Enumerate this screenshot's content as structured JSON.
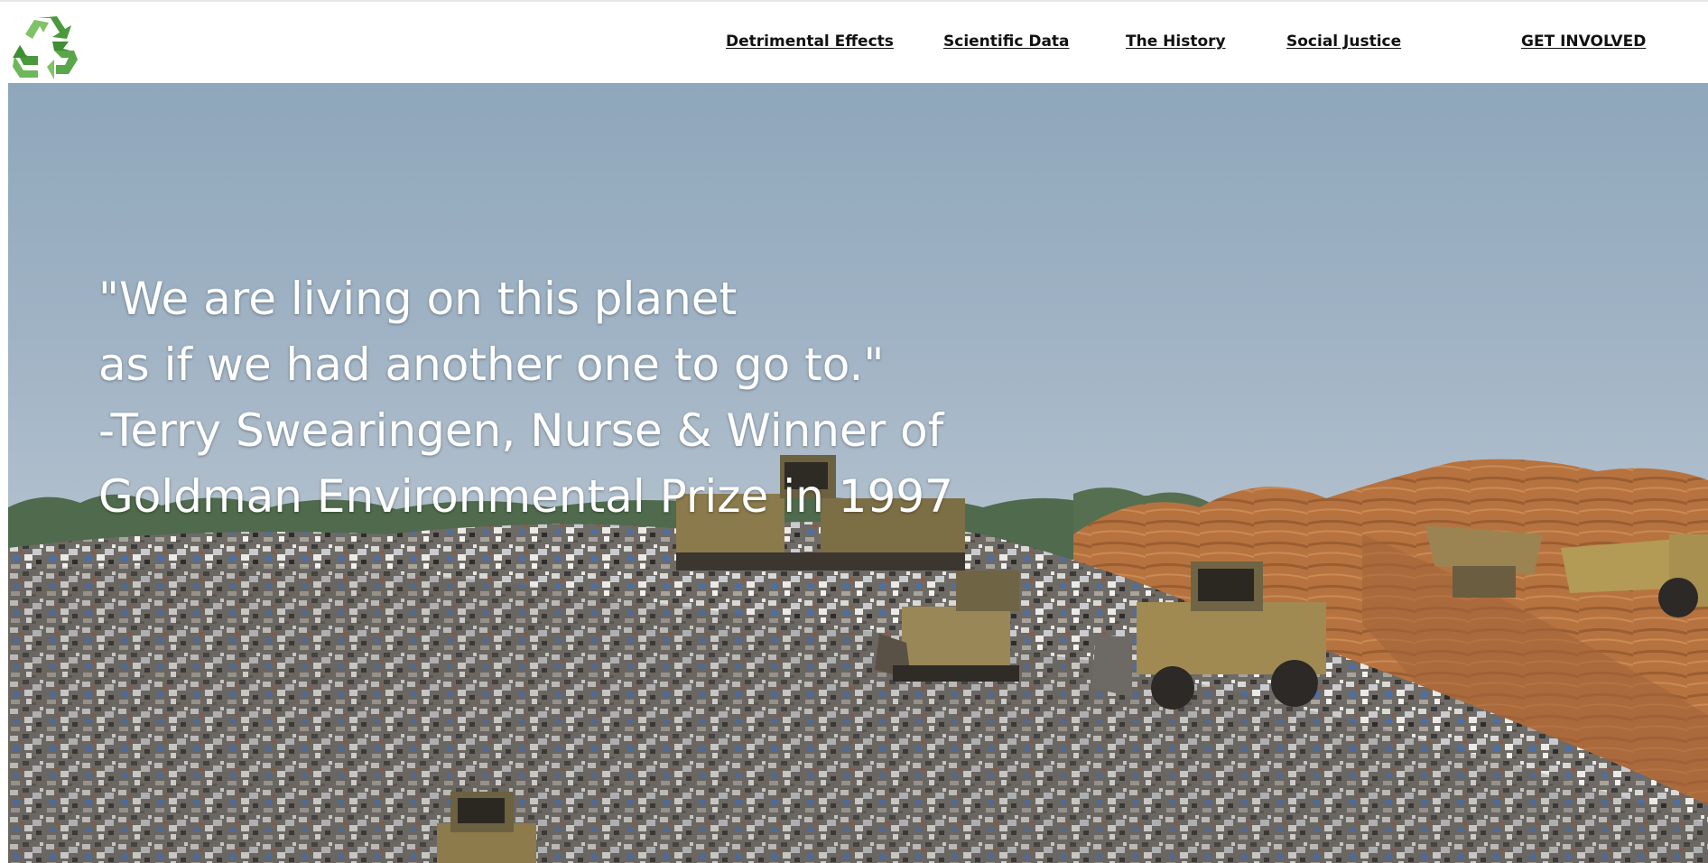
{
  "nav": {
    "logo_icon": "recycle-icon",
    "links": [
      {
        "label": "Detrimental Effects"
      },
      {
        "label": "Scientific Data"
      },
      {
        "label": "The History"
      },
      {
        "label": "Social Justice"
      },
      {
        "label": "GET INVOLVED"
      }
    ]
  },
  "hero": {
    "image": "landfill-bulldozers-image",
    "quote_lines": [
      "\"We are living on this planet",
      "as if we had another one to go to.\"",
      "-Terry Swearingen, Nurse & Winner of",
      "Goldman Environmental Prize in 1997"
    ]
  },
  "colors": {
    "sky": "#9eb2c4",
    "recycle_green": "#5aa64a",
    "text_dark": "#111111",
    "quote_text": "#ffffff"
  }
}
